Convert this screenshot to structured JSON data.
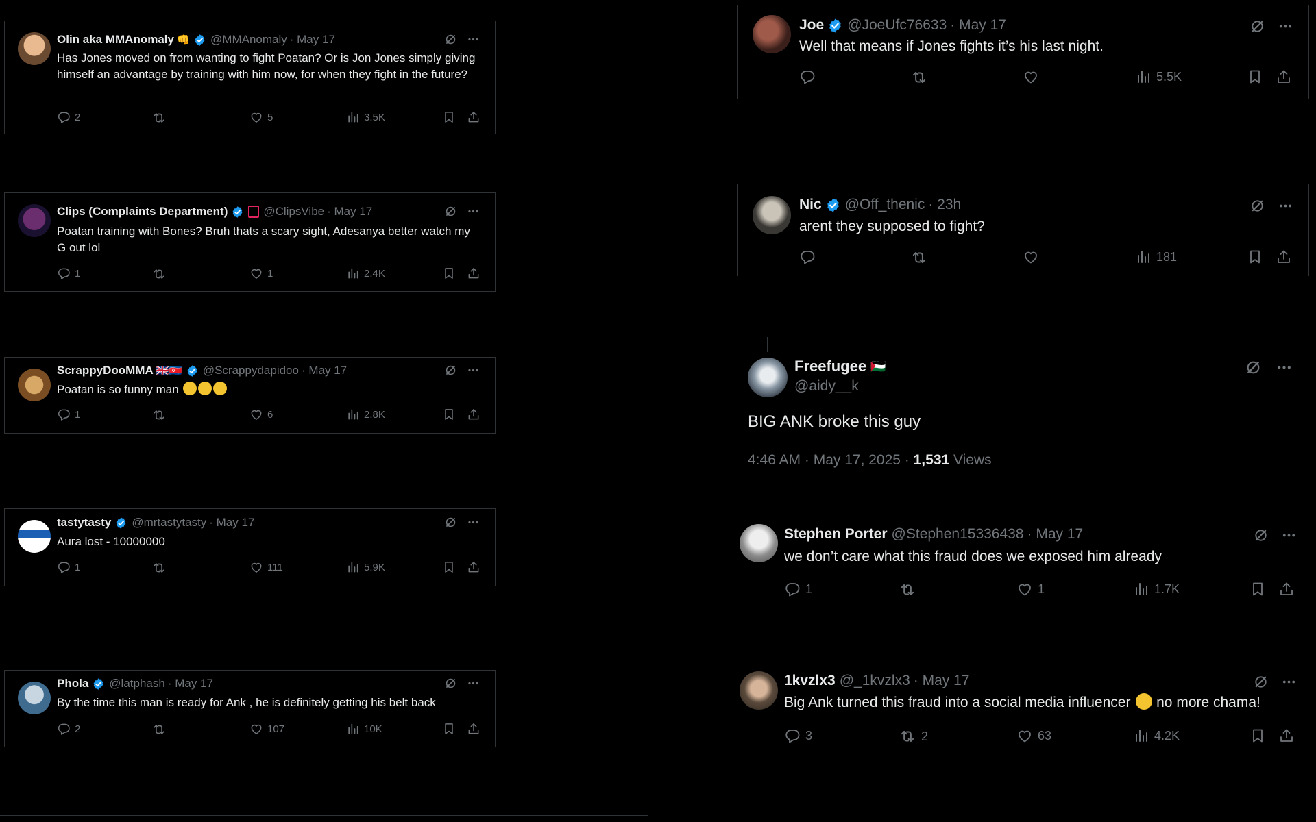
{
  "colors": {
    "background": "#000000",
    "text": "#e7e9ea",
    "muted": "#71767b",
    "border": "#2f3336",
    "verified": "#1d9bf0"
  },
  "icons": [
    "verified-badge-icon",
    "grok-icon",
    "more-icon",
    "reply-icon",
    "retweet-icon",
    "like-icon",
    "views-icon",
    "bookmark-icon",
    "share-icon"
  ],
  "left_tweets": [
    {
      "name": "Olin aka MMAnomaly",
      "name_emoji": "👊",
      "handle": "@MMAnomaly",
      "date": "· May 17",
      "text": "Has Jones moved on from wanting to fight Poatan? Or is Jon Jones simply giving himself an advantage by training with him now, for when they fight in the future?",
      "replies": "2",
      "retweets": "",
      "likes": "5",
      "views": "3.5K"
    },
    {
      "name": "Clips (Complaints Department)",
      "name_emoji": "",
      "handle": "@ClipsVibe",
      "date": "· May 17",
      "text": "Poatan training with Bones? Bruh thats a scary sight, Adesanya better watch my G out lol",
      "replies": "1",
      "retweets": "",
      "likes": "1",
      "views": "2.4K"
    },
    {
      "name": "ScrappyDooMMA",
      "name_emoji": "🇬🇧🇰🇵",
      "handle": "@Scrappydapidoo",
      "date": "· May 17",
      "text": "Poatan is so funny man ",
      "replies": "1",
      "retweets": "",
      "likes": "6",
      "views": "2.8K"
    },
    {
      "name": "tastytasty",
      "name_emoji": "",
      "handle": "@mrtastytasty",
      "date": "· May 17",
      "text": "Aura lost - 10000000",
      "replies": "1",
      "retweets": "",
      "likes": "111",
      "views": "5.9K"
    },
    {
      "name": "Phola",
      "name_emoji": "",
      "handle": "@latphash",
      "date": "· May 17",
      "text": "By the time this man is ready for Ank , he is definitely getting his belt back",
      "replies": "2",
      "retweets": "",
      "likes": "107",
      "views": "10K"
    }
  ],
  "right_tweets": [
    {
      "name": "Joe",
      "handle": "@JoeUfc76633",
      "date": "· May 17",
      "text": "Well that means if Jones fights it’s his last night.",
      "replies": "",
      "retweets": "",
      "likes": "",
      "views": "5.5K"
    },
    {
      "name": "Nic",
      "handle": "@Off_thenic",
      "date": "· 23h",
      "text": "arent they supposed to fight?",
      "replies": "",
      "retweets": "",
      "likes": "",
      "views": "181"
    },
    {
      "name": "Stephen Porter",
      "handle": "@Stephen15336438",
      "date": "· May 17",
      "text": "we don’t care what this fraud does we exposed him already",
      "replies": "1",
      "retweets": "",
      "likes": "1",
      "views": "1.7K"
    },
    {
      "name": "1kvzlx3",
      "handle": "@_1kvzlx3",
      "date": "· May 17",
      "text": "Big Ank turned this fraud into a social media influencer ",
      "text_after": " no more chama!",
      "replies": "3",
      "retweets": "2",
      "likes": "63",
      "views": "4.2K"
    }
  ],
  "main_tweet": {
    "name": "Freefugee",
    "name_flag": "🇵🇸",
    "handle": "@aidy__k",
    "text": "BIG ANK broke this guy",
    "time": "4:46 AM · May 17, 2025 · ",
    "views_count": "1,531",
    "views_label": " Views"
  }
}
